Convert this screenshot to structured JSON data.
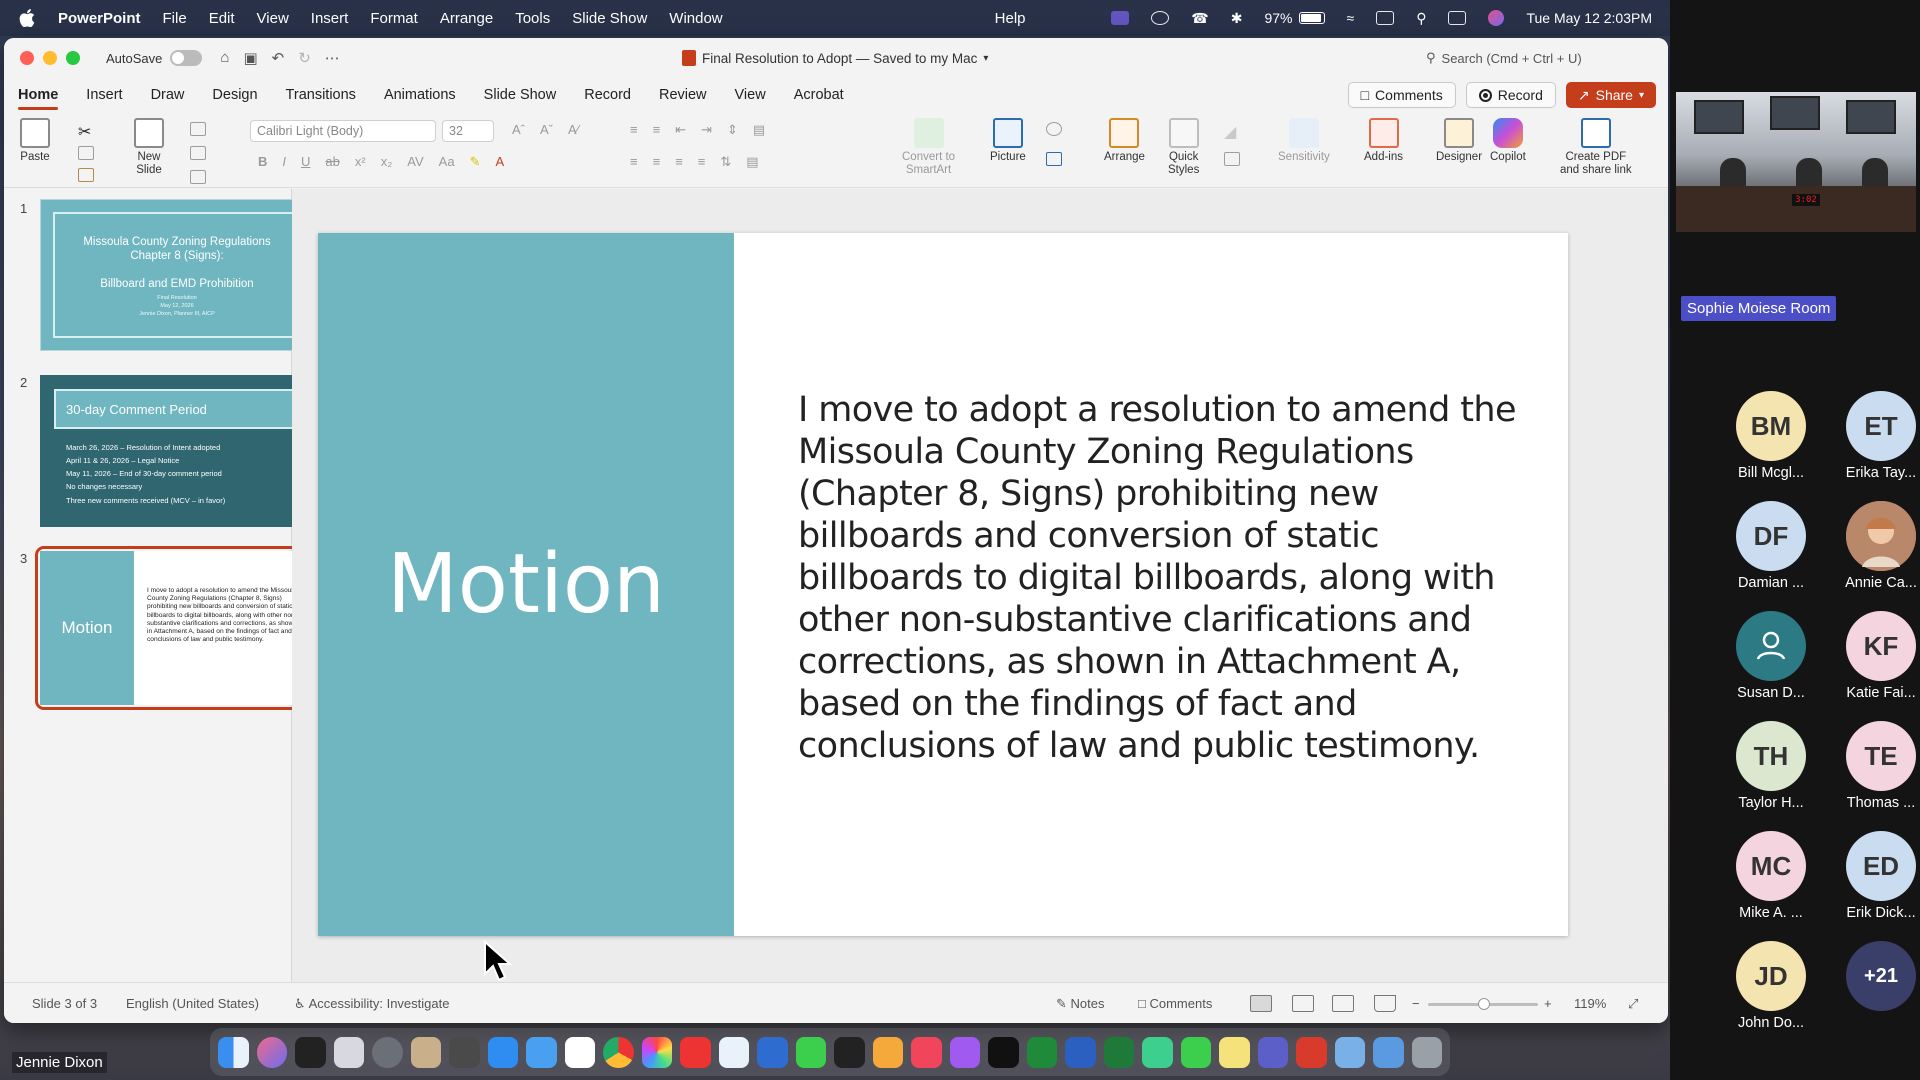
{
  "menubar": {
    "app": "PowerPoint",
    "items": [
      "File",
      "Edit",
      "View",
      "Insert",
      "Format",
      "Arrange",
      "Tools",
      "Slide Show",
      "Window"
    ],
    "help": "Help",
    "battery": "97%",
    "datetime": "Tue May 12  2:03PM"
  },
  "window": {
    "autosave_label": "AutoSave",
    "doc_title": "Final Resolution to Adopt — Saved to my Mac",
    "search_placeholder": "Search (Cmd + Ctrl + U)",
    "tabs": [
      "Home",
      "Insert",
      "Draw",
      "Design",
      "Transitions",
      "Animations",
      "Slide Show",
      "Record",
      "Review",
      "View",
      "Acrobat"
    ],
    "active_tab": "Home",
    "comments_label": "Comments",
    "record_label": "Record",
    "share_label": "Share"
  },
  "ribbon": {
    "paste": "Paste",
    "new_slide_line1": "New",
    "new_slide_line2": "Slide",
    "font_name": "Calibri Light (Body)",
    "font_size": "32",
    "convert_line1": "Convert to",
    "convert_line2": "SmartArt",
    "picture": "Picture",
    "arrange": "Arrange",
    "quick_styles_line1": "Quick",
    "quick_styles_line2": "Styles",
    "sensitivity": "Sensitivity",
    "addins": "Add-ins",
    "designer": "Designer",
    "copilot": "Copilot",
    "create_pdf_line1": "Create PDF",
    "create_pdf_line2": "and share link"
  },
  "thumbnails": {
    "s1": {
      "num": "1",
      "title1": "Missoula County Zoning Regulations",
      "title2": "Chapter 8 (Signs):",
      "subtitle": "Billboard and EMD Prohibition",
      "small1": "Final Resolution",
      "small2": "May 12, 2026",
      "small3": "Jennie Dixon, Planner III, AICP"
    },
    "s2": {
      "num": "2",
      "title": "30-day Comment Period",
      "lines": [
        "March 26, 2026 – Resolution of Intent adopted",
        "April 11 & 26, 2026 – Legal Notice",
        "May 11, 2026 – End of 30-day comment period",
        "No changes necessary",
        "Three new comments received (MCV – in favor)"
      ]
    },
    "s3": {
      "num": "3",
      "title": "Motion",
      "text": "I move to adopt a resolution to amend the Missoula County Zoning Regulations (Chapter 8, Signs) prohibiting new billboards and conversion of static billboards to digital billboards, along with other non-substantive clarifications and corrections, as shown in Attachment A, based on the findings of fact and conclusions of law and public testimony."
    }
  },
  "slide": {
    "title": "Motion",
    "body": "I move to adopt a resolution to amend the Missoula County Zoning Regulations (Chapter 8, Signs) prohibiting new billboards and conversion of static billboards to digital billboards, along with other non-substantive clarifications and corrections, as shown in Attachment A, based on the findings of fact and conclusions of law and public testimony."
  },
  "status": {
    "slide_count": "Slide 3 of 3",
    "language": "English (United States)",
    "accessibility": "Accessibility: Investigate",
    "notes": "Notes",
    "comments": "Comments",
    "zoom": "119%"
  },
  "presenter": "Jennie Dixon",
  "zoom_panel": {
    "room_label": "Sophie Moiese Room",
    "clock": "3:02",
    "participants": [
      {
        "initials": "BM",
        "name": "Bill Mcgl...",
        "color": "#f4e4b0"
      },
      {
        "initials": "ET",
        "name": "Erika Tay...",
        "color": "#c9dcf0"
      },
      {
        "initials": "DF",
        "name": "Damian ...",
        "color": "#c9dcf0"
      },
      {
        "initials": "",
        "name": "Annie Ca...",
        "color": "#b9876a"
      },
      {
        "initials": "",
        "name": "Susan D...",
        "color": "#2c7a84"
      },
      {
        "initials": "KF",
        "name": "Katie Fai...",
        "color": "#f4d4de"
      },
      {
        "initials": "TH",
        "name": "Taylor H...",
        "color": "#dbe8cf"
      },
      {
        "initials": "TE",
        "name": "Thomas ...",
        "color": "#f4d4de"
      },
      {
        "initials": "MC",
        "name": "Mike A. ...",
        "color": "#f4d4de"
      },
      {
        "initials": "ED",
        "name": "Erik Dick...",
        "color": "#c9dcf0"
      },
      {
        "initials": "JD",
        "name": "John Do...",
        "color": "#f4e4b0"
      },
      {
        "initials": "+21",
        "name": "",
        "color": "#3a3f6a"
      }
    ]
  },
  "colors": {
    "accent": "#c43e1c",
    "slide_teal": "#6fb6c1",
    "slide_dark": "#2f6670"
  }
}
